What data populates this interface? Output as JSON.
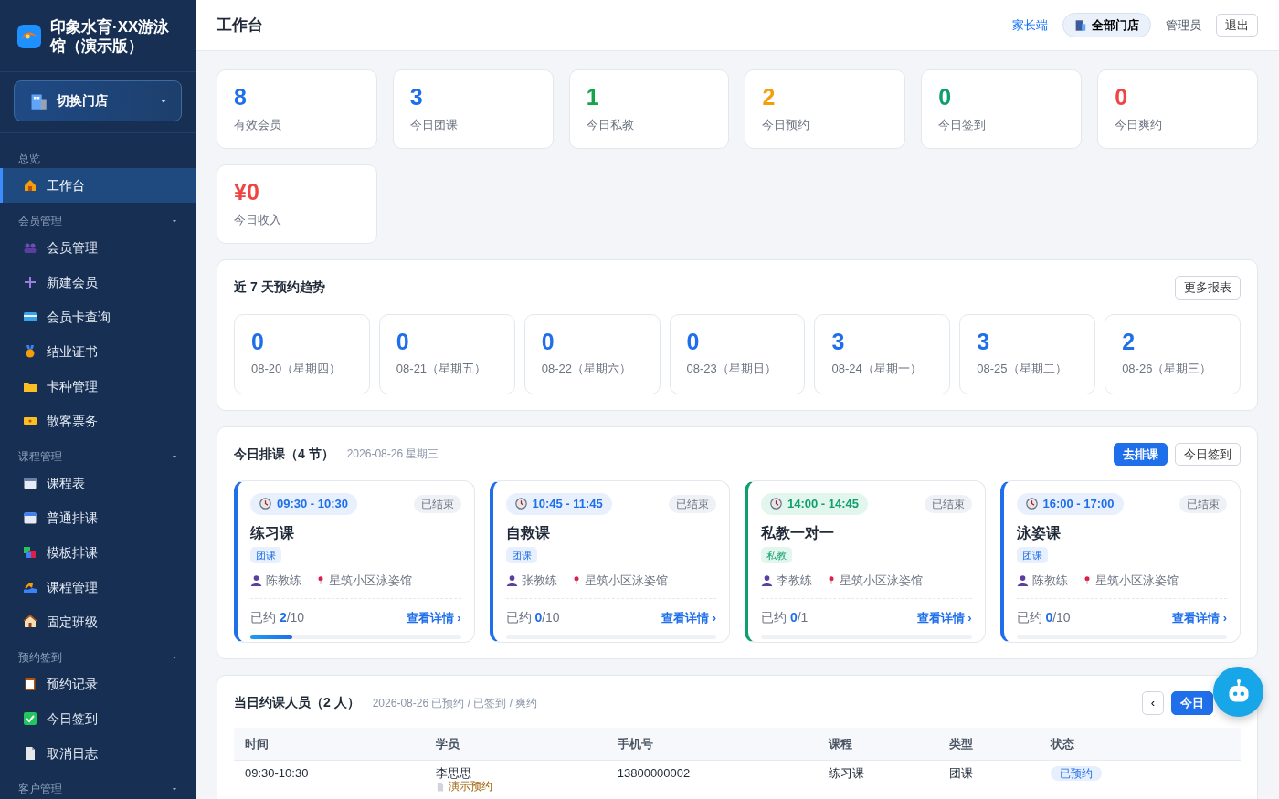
{
  "brand": {
    "name": "印象水育·XX游泳馆（演示版）"
  },
  "store_switcher": {
    "label": "切换门店"
  },
  "sidebar": {
    "groups": [
      {
        "title": "总览",
        "items": [
          {
            "label": "工作台",
            "selected": true
          }
        ]
      },
      {
        "title": "会员管理",
        "expanded": true,
        "items": [
          {
            "label": "会员管理",
            "selected": false
          },
          {
            "label": "新建会员",
            "selected": false
          },
          {
            "label": "会员卡查询",
            "selected": false
          },
          {
            "label": "结业证书",
            "selected": false
          },
          {
            "label": "卡种管理",
            "selected": false
          },
          {
            "label": "散客票务",
            "selected": false
          }
        ]
      },
      {
        "title": "课程管理",
        "expanded": true,
        "items": [
          {
            "label": "课程表",
            "selected": false
          },
          {
            "label": "普通排课",
            "selected": false
          },
          {
            "label": "模板排课",
            "selected": false
          },
          {
            "label": "课程管理",
            "selected": false
          },
          {
            "label": "固定班级",
            "selected": false
          }
        ]
      },
      {
        "title": "预约签到",
        "expanded": true,
        "items": [
          {
            "label": "预约记录",
            "selected": false
          },
          {
            "label": "今日签到",
            "selected": false
          },
          {
            "label": "取消日志",
            "selected": false
          }
        ]
      },
      {
        "title": "客户管理",
        "expanded": true
      }
    ]
  },
  "header": {
    "title": "工作台",
    "parent_link": "家长端",
    "store_pill": "全部门店",
    "user": "管理员",
    "logout": "退出"
  },
  "stats": [
    {
      "value": "8",
      "label": "有效会员",
      "color": "#1f6feb"
    },
    {
      "value": "3",
      "label": "今日团课",
      "color": "#1f6feb"
    },
    {
      "value": "1",
      "label": "今日私教",
      "color": "#16a34a"
    },
    {
      "value": "2",
      "label": "今日预约",
      "color": "#f59e0b"
    },
    {
      "value": "0",
      "label": "今日签到",
      "color": "#0f9f6e"
    },
    {
      "value": "0",
      "label": "今日爽约",
      "color": "#ef4444"
    },
    {
      "value": "¥0",
      "label": "今日收入",
      "color": "#ef4444"
    }
  ],
  "trend": {
    "title": "近 7 天预约趋势",
    "button": "更多报表",
    "days": [
      {
        "value": "0",
        "date": "08-20（星期四）"
      },
      {
        "value": "0",
        "date": "08-21（星期五）"
      },
      {
        "value": "0",
        "date": "08-22（星期六）"
      },
      {
        "value": "0",
        "date": "08-23（星期日）"
      },
      {
        "value": "3",
        "date": "08-24（星期一）"
      },
      {
        "value": "3",
        "date": "08-25（星期二）"
      },
      {
        "value": "2",
        "date": "08-26（星期三）"
      }
    ]
  },
  "schedule": {
    "title": "今日排课（4 节）",
    "subtitle": "2026-08-26 星期三",
    "buttons": [
      {
        "label": "去排课",
        "primary": true
      },
      {
        "label": "今日签到",
        "primary": false
      }
    ],
    "courses": [
      {
        "time": "09:30 - 10:30",
        "status": "已结束",
        "name": "练习课",
        "tag": "团课",
        "color": "#1f6feb",
        "coach": "陈教练",
        "venue": "星筑小区泳姿馆",
        "booked_label": "已约",
        "booked": "2",
        "capacity": "/10",
        "level": 0.2,
        "link": "查看详情 ›"
      },
      {
        "time": "10:45 - 11:45",
        "status": "已结束",
        "name": "自救课",
        "tag": "团课",
        "color": "#1f6feb",
        "coach": "张教练",
        "venue": "星筑小区泳姿馆",
        "booked_label": "已约",
        "booked": "0",
        "capacity": "/10",
        "level": 0,
        "link": "查看详情 ›"
      },
      {
        "time": "14:00 - 14:45",
        "status": "已结束",
        "name": "私教一对一",
        "tag": "私教",
        "color": "#0f9f6e",
        "coach": "李教练",
        "venue": "星筑小区泳姿馆",
        "booked_label": "已约",
        "booked": "0",
        "capacity": "/1",
        "level": 0,
        "link": "查看详情 ›"
      },
      {
        "time": "16:00 - 17:00",
        "status": "已结束",
        "name": "泳姿课",
        "tag": "团课",
        "color": "#1f6feb",
        "coach": "陈教练",
        "venue": "星筑小区泳姿馆",
        "booked_label": "已约",
        "booked": "0",
        "capacity": "/10",
        "level": 0,
        "link": "查看详情 ›"
      }
    ]
  },
  "attendees": {
    "title": "当日约课人员（2 人）",
    "subtitle": "2026-08-26 已预约 / 已签到 / 爽约",
    "prev": "‹",
    "today": "今日",
    "table": {
      "columns": [
        "时间",
        "学员",
        "手机号",
        "课程",
        "类型",
        "状态"
      ],
      "rows": [
        {
          "time": "09:30-10:30",
          "student": "李思思",
          "note": "演示预约",
          "phone": "13800000002",
          "course": "练习课",
          "type": "团课",
          "status": "已预约"
        }
      ]
    }
  }
}
